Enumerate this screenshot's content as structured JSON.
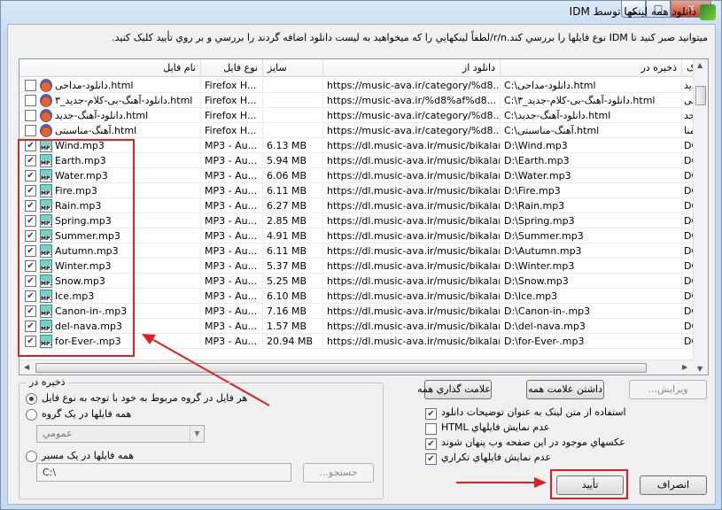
{
  "window": {
    "title": "دانلود همه لينکها توسط IDM",
    "controls": {
      "minimize": "▁",
      "maximize": "▢",
      "close": "✕"
    }
  },
  "info_text": "ميتوانيد صبر کنيد تا IDM نوع فايلها را بررسي کند.r/n/لطفاً لينکهايي را که ميخواهيد به ليست دانلود اضافه گردند را بررسي و بر روي تأييد کليک کنيد.",
  "columns": [
    "نام فايل",
    "نوع فايل",
    "سايز",
    "دانلود از",
    "ذخيره در",
    "ـنک"
  ],
  "rows": [
    {
      "checked": false,
      "icon": "html",
      "name": "دانلود-مداحی.html",
      "type": "Firefox H...",
      "size": "",
      "url": "https://music-ava.ir/category/%d8...",
      "save": "C:\\دانلود-مداحی.html",
      "extra": "جدید"
    },
    {
      "checked": false,
      "icon": "html",
      "name": "دانلود-آهنگ-بی-کلام-جدید_۳.html",
      "type": "Firefox H...",
      "size": "",
      "url": "https://music-ava.ir/%d8%af%d8...",
      "save": "C:\\دانلود-آهنگ-بی-کلام-جدید_۳.html",
      "extra": "بی"
    },
    {
      "checked": false,
      "icon": "html",
      "name": "دانلود-آهنگ-جدید.html",
      "type": "Firefox H...",
      "size": "",
      "url": "https://music-ava.ir/category/%d8...",
      "save": "C:\\دانلود-آهنگ-جدید.html",
      "extra": "جد"
    },
    {
      "checked": false,
      "icon": "html",
      "name": "آهنگ-مناسبتی.html",
      "type": "Firefox H...",
      "size": "",
      "url": "https://music-ava.ir/category/%d8...",
      "save": "C:\\آهنگ-مناسبتی.html",
      "extra": "منا"
    },
    {
      "checked": true,
      "icon": "mp3",
      "name": "Wind.mp3",
      "type": "MP3 - Au...",
      "size": "6.13  MB",
      "url": "https://dl.music-ava.ir/music/bikalam...",
      "save": "D:\\Wind.mp3",
      "extra": "DO"
    },
    {
      "checked": true,
      "icon": "mp3",
      "name": "Earth.mp3",
      "type": "MP3 - Au...",
      "size": "5.94  MB",
      "url": "https://dl.music-ava.ir/music/bikalam...",
      "save": "D:\\Earth.mp3",
      "extra": "DO"
    },
    {
      "checked": true,
      "icon": "mp3",
      "name": "Water.mp3",
      "type": "MP3 - Au...",
      "size": "6.06  MB",
      "url": "https://dl.music-ava.ir/music/bikalam...",
      "save": "D:\\Water.mp3",
      "extra": "DO"
    },
    {
      "checked": true,
      "icon": "mp3",
      "name": "Fire.mp3",
      "type": "MP3 - Au...",
      "size": "6.11  MB",
      "url": "https://dl.music-ava.ir/music/bikalam...",
      "save": "D:\\Fire.mp3",
      "extra": "DO"
    },
    {
      "checked": true,
      "icon": "mp3",
      "name": "Rain.mp3",
      "type": "MP3 - Au...",
      "size": "6.27  MB",
      "url": "https://dl.music-ava.ir/music/bikalam...",
      "save": "D:\\Rain.mp3",
      "extra": "DO"
    },
    {
      "checked": true,
      "icon": "mp3",
      "name": "Spring.mp3",
      "type": "MP3 - Au...",
      "size": "2.85  MB",
      "url": "https://dl.music-ava.ir/music/bikalam...",
      "save": "D:\\Spring.mp3",
      "extra": "DO"
    },
    {
      "checked": true,
      "icon": "mp3",
      "name": "Summer.mp3",
      "type": "MP3 - Au...",
      "size": "4.91  MB",
      "url": "https://dl.music-ava.ir/music/bikalam...",
      "save": "D:\\Summer.mp3",
      "extra": "DO"
    },
    {
      "checked": true,
      "icon": "mp3",
      "name": "Autumn.mp3",
      "type": "MP3 - Au...",
      "size": "6.11  MB",
      "url": "https://dl.music-ava.ir/music/bikalam...",
      "save": "D:\\Autumn.mp3",
      "extra": "DO"
    },
    {
      "checked": true,
      "icon": "mp3",
      "name": "Winter.mp3",
      "type": "MP3 - Au...",
      "size": "5.37  MB",
      "url": "https://dl.music-ava.ir/music/bikalam...",
      "save": "D:\\Winter.mp3",
      "extra": "DO"
    },
    {
      "checked": true,
      "icon": "mp3",
      "name": "Snow.mp3",
      "type": "MP3 - Au...",
      "size": "5.25  MB",
      "url": "https://dl.music-ava.ir/music/bikalam...",
      "save": "D:\\Snow.mp3",
      "extra": "DO"
    },
    {
      "checked": true,
      "icon": "mp3",
      "name": "Ice.mp3",
      "type": "MP3 - Au...",
      "size": "6.10  MB",
      "url": "https://dl.music-ava.ir/music/bikalam...",
      "save": "D:\\Ice.mp3",
      "extra": "DO"
    },
    {
      "checked": true,
      "icon": "mp3",
      "name": "Canon-in-.mp3",
      "type": "MP3 - Au...",
      "size": "7.16  MB",
      "url": "https://dl.music-ava.ir/music/bikalam...",
      "save": "D:\\Canon-in-.mp3",
      "extra": "DO"
    },
    {
      "checked": true,
      "icon": "mp3",
      "name": "del-nava.mp3",
      "type": "MP3 - Au...",
      "size": "1.57  MB",
      "url": "https://dl.music-ava.ir/music/bikalam...",
      "save": "D:\\del-nava.mp3",
      "extra": "DO"
    },
    {
      "checked": true,
      "icon": "mp3",
      "name": "for-Ever-.mp3",
      "type": "MP3 - Au...",
      "size": "20.94  MB",
      "url": "https://dl.music-ava.ir/music/bikalam...",
      "save": "D:\\for-Ever-.mp3",
      "extra": "DO"
    }
  ],
  "save_group": {
    "label": "ذخيره در",
    "option1": "هر فايل در گروه مربوط به خود با توجه به نوع فايل",
    "option2": "همه فايلها در يک گروه",
    "group_value": "عمومي",
    "option3": "همه فايلها در يک مسير",
    "path_value": "C:\\",
    "browse_label": "جستجو..."
  },
  "buttons": {
    "mark_all": "علامت گذاري همه",
    "unmark_all": "داشتن علامت همه",
    "edit": "ويرايش...",
    "ok": "تأييد",
    "cancel": "انصراف"
  },
  "options": [
    {
      "label": "استفاده از متن لينک به عنوان توضيحات دانلود",
      "checked": true
    },
    {
      "label": "عدم نمايش فايلهاي HTML",
      "checked": false
    },
    {
      "label": "عکسهاي موجود در اين صفحه وب پنهان شوند",
      "checked": true
    },
    {
      "label": "عدم نمايش فايلهاي تکراري",
      "checked": true
    }
  ],
  "colors": {
    "highlight": "#e02020"
  }
}
